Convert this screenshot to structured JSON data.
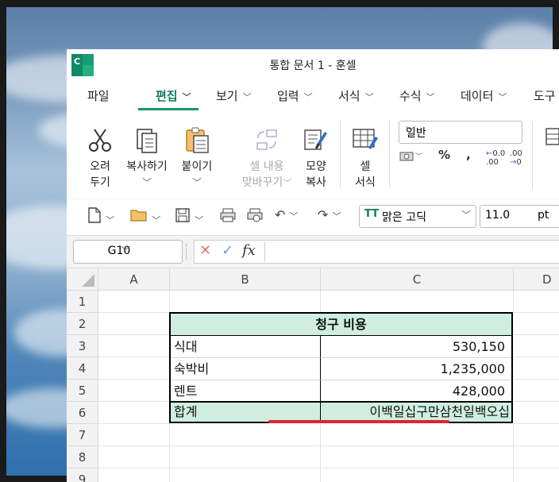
{
  "window": {
    "title": "통합 문서 1 - 훈셀"
  },
  "menu_tabs": [
    {
      "label": "파일",
      "chevron": false
    },
    {
      "label": "편집",
      "chevron": true,
      "active": true
    },
    {
      "label": "보기",
      "chevron": true
    },
    {
      "label": "입력",
      "chevron": true
    },
    {
      "label": "서식",
      "chevron": true
    },
    {
      "label": "수식",
      "chevron": true
    },
    {
      "label": "데이터",
      "chevron": true
    },
    {
      "label": "도구",
      "chevron": false
    }
  ],
  "ribbon": {
    "cut": [
      "오려",
      "두기"
    ],
    "copy": [
      "복사하기"
    ],
    "paste": [
      "붙이기"
    ],
    "paste_format": [
      "셀 내용",
      "맞바꾸기"
    ],
    "format_painter": [
      "모양",
      "복사"
    ],
    "cell_style": [
      "셀",
      "서식"
    ],
    "number_format": "일반",
    "percent": "%",
    "comma": ","
  },
  "toolbar": {
    "font": "맑은 고딕",
    "size": "11.0",
    "size_unit": "pt"
  },
  "formula_bar": {
    "cell_ref": "G10",
    "fx_label": "fx",
    "value": ""
  },
  "grid": {
    "columns": [
      "A",
      "B",
      "C",
      "D"
    ],
    "rows": [
      "1",
      "2",
      "3",
      "4",
      "5",
      "6",
      "7",
      "8",
      "9"
    ],
    "table_title": "청구 비용",
    "items": [
      {
        "label": "식대",
        "value": "530,150"
      },
      {
        "label": "숙박비",
        "value": "1,235,000"
      },
      {
        "label": "렌트",
        "value": "428,000"
      }
    ],
    "total_label": "합계",
    "total_value": "이백일십구만삼천일백오십"
  }
}
